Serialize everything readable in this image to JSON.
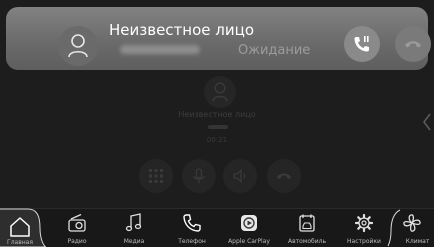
{
  "incoming_call": {
    "name": "Неизвестное лицо",
    "status": "Ожидание",
    "avatar_icon": "person-icon",
    "hold_icon": "phone-pause-icon",
    "hangup_icon": "phone-hangup-icon",
    "panel_color": "#747474"
  },
  "active_call": {
    "name": "Неизвестное лицо",
    "timer": "00:21",
    "avatar_icon": "person-icon",
    "controls": [
      "keypad-icon",
      "microphone-icon",
      "speaker-icon",
      "phone-hangup-icon"
    ]
  },
  "nav": {
    "items": [
      {
        "label": "Главная",
        "icon": "home-icon"
      },
      {
        "label": "Радио",
        "icon": "radio-icon"
      },
      {
        "label": "Медиа",
        "icon": "music-note-icon"
      },
      {
        "label": "Телефон",
        "icon": "phone-icon"
      },
      {
        "label": "Apple CarPlay",
        "icon": "carplay-icon"
      },
      {
        "label": "Автомобиль",
        "icon": "car-info-icon"
      },
      {
        "label": "Настройки",
        "icon": "gear-icon"
      },
      {
        "label": "Климат",
        "icon": "fan-icon"
      }
    ]
  }
}
